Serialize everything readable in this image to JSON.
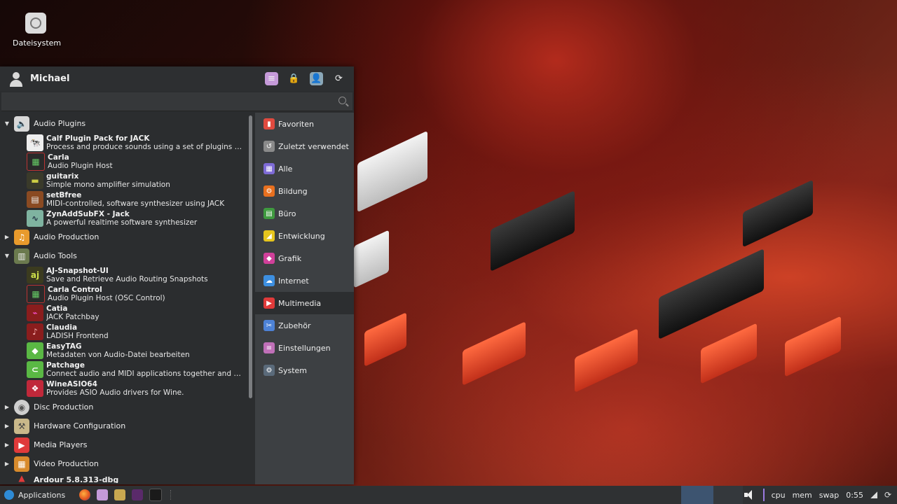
{
  "desktop": {
    "icon_label": "Dateisystem"
  },
  "menu": {
    "username": "Michael",
    "search_placeholder": "",
    "categories": [
      {
        "label": "Audio Plugins",
        "expanded": true,
        "icon": "speaker-icon",
        "apps": [
          {
            "name": "Calf Plugin Pack for JACK",
            "desc": "Process and produce sounds using a set of plugins with ...",
            "icon": "calf-icon"
          },
          {
            "name": "Carla",
            "desc": "Audio Plugin Host",
            "icon": "carla-icon"
          },
          {
            "name": "guitarix",
            "desc": "Simple mono amplifier simulation",
            "icon": "guitarix-icon"
          },
          {
            "name": "setBfree",
            "desc": "MIDI-controlled, software synthesizer using JACK",
            "icon": "organ-icon"
          },
          {
            "name": "ZynAddSubFX - Jack",
            "desc": "A powerful realtime software synthesizer",
            "icon": "zyn-icon"
          }
        ]
      },
      {
        "label": "Audio Production",
        "expanded": false,
        "icon": "music-note-icon"
      },
      {
        "label": "Audio Tools",
        "expanded": true,
        "icon": "audio-tools-icon",
        "apps": [
          {
            "name": "AJ-Snapshot-UI",
            "desc": "Save and Retrieve Audio Routing Snapshots",
            "icon": "aj-icon"
          },
          {
            "name": "Carla Control",
            "desc": "Audio Plugin Host (OSC Control)",
            "icon": "carla-control-icon"
          },
          {
            "name": "Catia",
            "desc": "JACK Patchbay",
            "icon": "catia-icon"
          },
          {
            "name": "Claudia",
            "desc": "LADISH Frontend",
            "icon": "claudia-icon"
          },
          {
            "name": "EasyTAG",
            "desc": "Metadaten von Audio-Datei bearbeiten",
            "icon": "tag-icon"
          },
          {
            "name": "Patchage",
            "desc": "Connect audio and MIDI applications together and man...",
            "icon": "patchage-icon"
          },
          {
            "name": "WineASIO64",
            "desc": "Provides ASIO Audio drivers for Wine.",
            "icon": "wine-icon"
          }
        ]
      },
      {
        "label": "Disc Production",
        "expanded": false,
        "icon": "disc-icon"
      },
      {
        "label": "Hardware Configuration",
        "expanded": false,
        "icon": "hardware-icon"
      },
      {
        "label": "Media Players",
        "expanded": false,
        "icon": "play-icon"
      },
      {
        "label": "Video Production",
        "expanded": false,
        "icon": "film-icon"
      },
      {
        "label": "Ardour 5.8.313-dbg",
        "expanded": false,
        "icon": "ardour-icon"
      }
    ],
    "filters": [
      {
        "label": "Favoriten",
        "icon": "bookmark-icon",
        "color": "#e04a3f"
      },
      {
        "label": "Zuletzt verwendet",
        "icon": "history-icon",
        "color": "#8a8a8a"
      },
      {
        "label": "Alle",
        "icon": "grid-icon",
        "color": "#7e6bd6"
      },
      {
        "label": "Bildung",
        "icon": "education-icon",
        "color": "#e8701f"
      },
      {
        "label": "Büro",
        "icon": "office-icon",
        "color": "#3f9a3f"
      },
      {
        "label": "Entwicklung",
        "icon": "development-icon",
        "color": "#e6c51d"
      },
      {
        "label": "Grafik",
        "icon": "graphics-icon",
        "color": "#d0409a"
      },
      {
        "label": "Internet",
        "icon": "cloud-icon",
        "color": "#3d8fe0"
      },
      {
        "label": "Multimedia",
        "icon": "multimedia-icon",
        "color": "#e03a3a",
        "active": true
      },
      {
        "label": "Zubehör",
        "icon": "accessories-icon",
        "color": "#4d82d6"
      },
      {
        "label": "Einstellungen",
        "icon": "settings-icon",
        "color": "#c070b8"
      },
      {
        "label": "System",
        "icon": "system-gear-icon",
        "color": "#5a6a7a"
      }
    ]
  },
  "taskbar": {
    "applications_label": "Applications",
    "cpu": "cpu",
    "mem": "mem",
    "swap": "swap",
    "clock": "0:55"
  }
}
